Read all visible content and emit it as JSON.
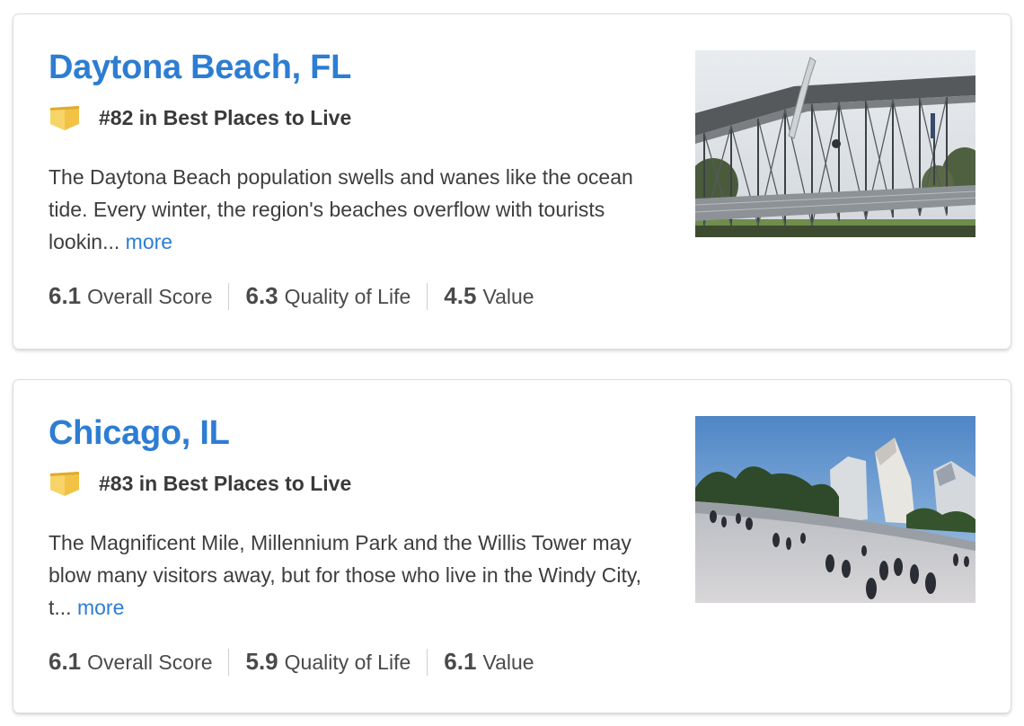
{
  "cards": [
    {
      "city": "Daytona Beach, FL",
      "rank_text": "#82 in Best Places to Live",
      "description": "The Daytona Beach population swells and wanes like the ocean tide. Every winter, the region's beaches overflow with tourists lookin...",
      "more_label": "more",
      "image_icon": "photo-speedway-grandstand",
      "scores": [
        {
          "value": "6.1",
          "label": "Overall Score"
        },
        {
          "value": "6.3",
          "label": "Quality of Life"
        },
        {
          "value": "4.5",
          "label": "Value"
        }
      ]
    },
    {
      "city": "Chicago, IL",
      "rank_text": "#83 in Best Places to Live",
      "description": "The Magnificent Mile, Millennium Park and the Willis Tower may blow many visitors away, but for those who live in the Windy City, t...",
      "more_label": "more",
      "image_icon": "photo-millennium-park",
      "scores": [
        {
          "value": "6.1",
          "label": "Overall Score"
        },
        {
          "value": "5.9",
          "label": "Quality of Life"
        },
        {
          "value": "6.1",
          "label": "Value"
        }
      ]
    }
  ],
  "colors": {
    "link_blue": "#2d7dd2",
    "badge_gold": "#f2c244"
  }
}
